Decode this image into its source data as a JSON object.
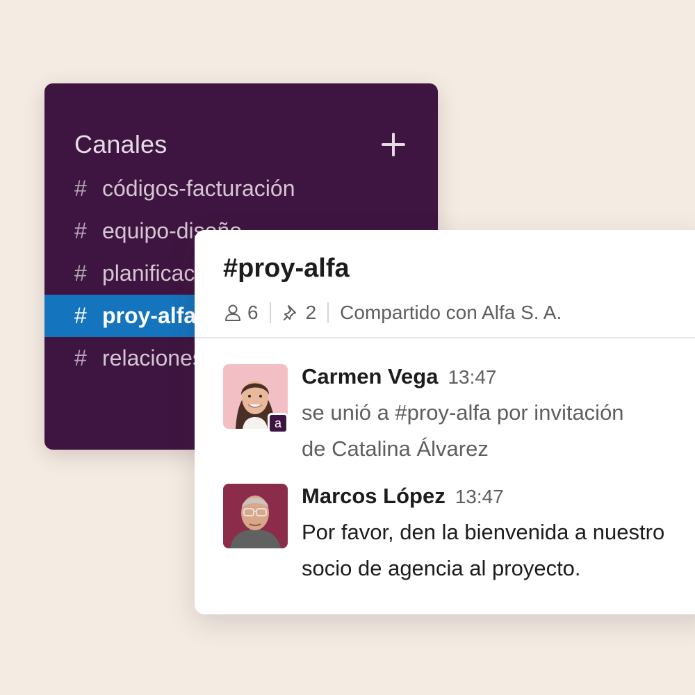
{
  "sidebar": {
    "title": "Canales",
    "add_icon": "plus-icon",
    "channels": [
      {
        "prefix": "#",
        "name": "códigos-facturación",
        "active": false
      },
      {
        "prefix": "#",
        "name": "equipo-diseño",
        "active": false
      },
      {
        "prefix": "#",
        "name": "planificación",
        "active": false
      },
      {
        "prefix": "#",
        "name": "proy-alfa",
        "active": true
      },
      {
        "prefix": "#",
        "name": "relaciones",
        "active": false
      }
    ]
  },
  "channel": {
    "title": "#proy-alfa",
    "members_icon": "person-icon",
    "members_count": "6",
    "pins_icon": "pin-icon",
    "pins_count": "2",
    "shared_text": "Compartido con Alfa S. A."
  },
  "messages": [
    {
      "author": "Carmen Vega",
      "time": "13:47",
      "badge": "a",
      "lines": [
        "se unió a #proy-alfa por invitación",
        "de Catalina Álvarez"
      ],
      "avatar_icon": "avatar-carmen"
    },
    {
      "author": "Marcos López",
      "time": "13:47",
      "lines": [
        "Por favor, den la bienvenida a nuestro",
        "socio de agencia al proyecto."
      ],
      "avatar_icon": "avatar-marcos"
    }
  ],
  "colors": {
    "background": "#f4ece3",
    "sidebar": "#3e1540",
    "active_channel": "#1474bd",
    "panel": "#ffffff"
  }
}
